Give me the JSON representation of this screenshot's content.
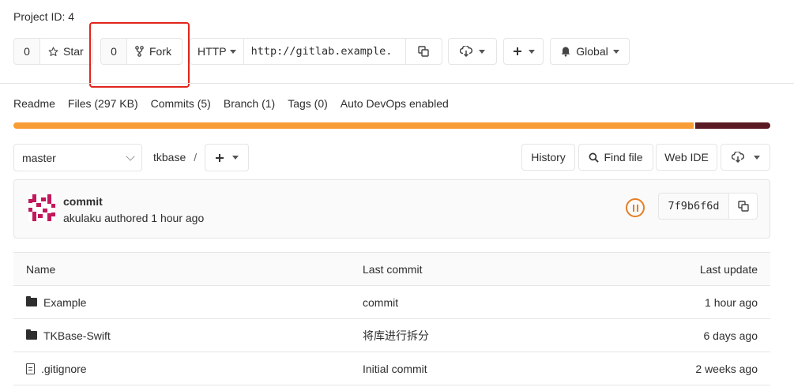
{
  "project": {
    "id_label": "Project ID: 4"
  },
  "star": {
    "count": "0",
    "label": "Star"
  },
  "fork": {
    "count": "0",
    "label": "Fork"
  },
  "clone": {
    "protocol": "HTTP",
    "url": "http://gitlab.example."
  },
  "notifications": {
    "label": "Global"
  },
  "stats": {
    "readme": "Readme",
    "files": "Files (297 KB)",
    "commits": "Commits (5)",
    "branch": "Branch (1)",
    "tags": "Tags (0)",
    "devops": "Auto DevOps enabled"
  },
  "languages": [
    {
      "color": "#f89d35",
      "share": 0.9
    },
    {
      "color": "#5a1a23",
      "share": 0.1
    }
  ],
  "repo": {
    "branch": "master",
    "path": "tkbase",
    "separator": "/",
    "history": "History",
    "find_file": "Find file",
    "web_ide": "Web IDE"
  },
  "last_commit": {
    "title": "commit",
    "meta": "akulaku authored 1 hour ago",
    "sha": "7f9b6f6d",
    "pipeline_status": "paused"
  },
  "tree": {
    "headers": {
      "name": "Name",
      "last_commit": "Last commit",
      "last_update": "Last update"
    },
    "rows": [
      {
        "type": "folder",
        "name": "Example",
        "commit": "commit",
        "updated": "1 hour ago"
      },
      {
        "type": "folder",
        "name": "TKBase-Swift",
        "commit": "将库进行拆分",
        "updated": "6 days ago"
      },
      {
        "type": "file",
        "name": ".gitignore",
        "commit": "Initial commit",
        "updated": "2 weeks ago"
      }
    ]
  }
}
